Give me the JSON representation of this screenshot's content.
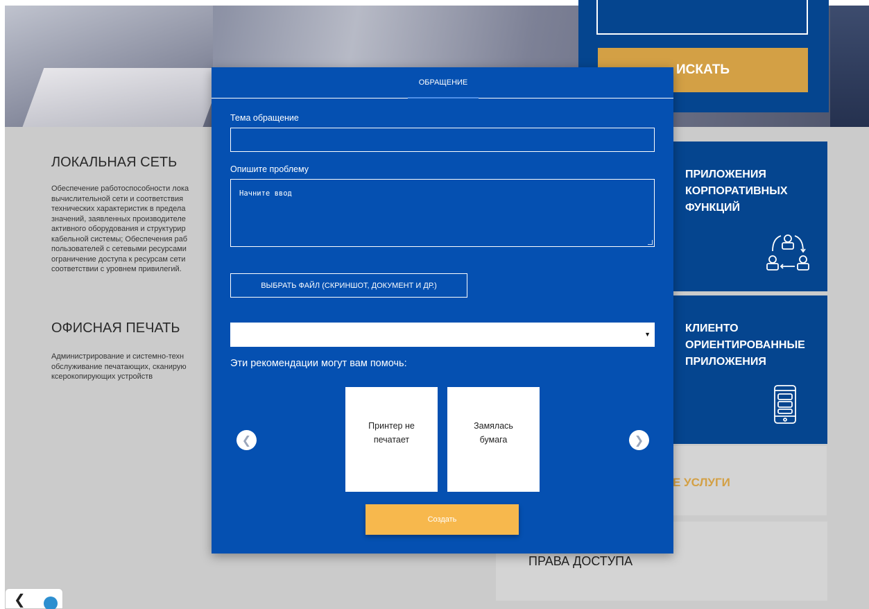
{
  "header": {
    "search_button_label": "ИСКАТЬ"
  },
  "sections": [
    {
      "title": "ЛОКАЛЬНАЯ СЕТЬ",
      "lines": [
        "Обеспечение работоспособности лока",
        "вычислительной сети и соответствия",
        "технических характеристик в предела",
        "значений, заявленных производителе",
        "активного оборудования и структурир",
        "кабельной системы; Обеспечения раб",
        "пользователей с сетевыми ресурсами",
        "ограничение доступа к ресурсам сети",
        "соответствии с уровнем привилегий."
      ]
    },
    {
      "title": "ОФИСНАЯ ПЕЧАТЬ",
      "lines": [
        "Администрирование и системно-техн",
        "обслуживание печатающих, сканирую",
        "ксерокопирующих устройств"
      ]
    }
  ],
  "tiles": [
    {
      "lines": [
        "ПРИЛОЖЕНИЯ",
        "КОРПОРАТИВНЫХ",
        "ФУНКЦИЙ"
      ],
      "icon": "people-exchange-icon"
    },
    {
      "lines": [
        "КЛИЕНТО",
        "ОРИЕНТИРОВАННЫЕ",
        "ПРИЛОЖЕНИЯ"
      ],
      "icon": "mobile-chat-icon"
    }
  ],
  "services_label": "Е УСЛУГИ",
  "access_label": "ПРАВА ДОСТУПА",
  "modal": {
    "tab_label": "ОБРАЩЕНИЕ",
    "subject_label": "Тема обращение",
    "subject_value": "",
    "problem_label": "Опишите проблему",
    "problem_placeholder": "Начните ввод",
    "file_button_label": "ВЫБРАТЬ ФАЙЛ (СКРИНШОТ, ДОКУМЕНТ И ДР.)",
    "select_value": "",
    "hint_label": "Эти рекомендации могут вам помочь:",
    "recommendations": [
      {
        "line1": "Принтер не",
        "line2": "печатает"
      },
      {
        "line1": "Замялась",
        "line2": "бумага"
      }
    ],
    "create_button_label": "Создать"
  },
  "colors": {
    "modal_bg": "#0550b1",
    "tile_bg": "#05458f",
    "accent_gold": "#d3a045",
    "create_button": "#f7b84d"
  }
}
